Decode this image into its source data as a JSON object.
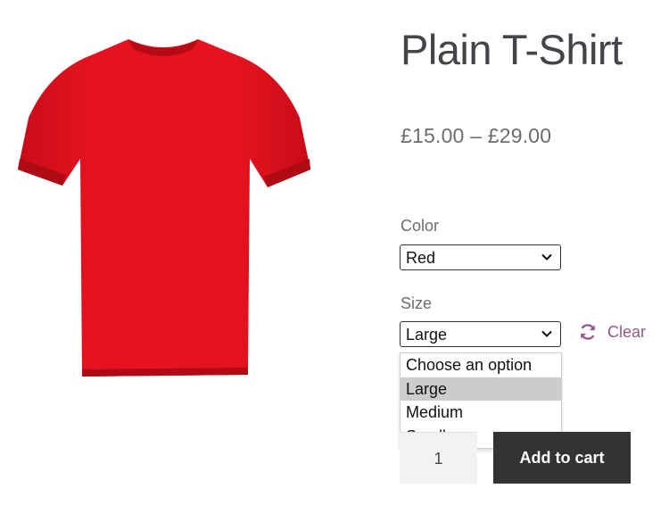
{
  "product": {
    "title": "Plain T-Shirt",
    "price_range": "£15.00 – £29.00",
    "image_icon": "red-tshirt-image",
    "image_color": "#e0101e"
  },
  "variations": {
    "color": {
      "label": "Color",
      "selected": "Red"
    },
    "size": {
      "label": "Size",
      "selected": "Large",
      "options": [
        "Choose an option",
        "Large",
        "Medium",
        "Small"
      ],
      "highlighted": "Large"
    },
    "clear_label": "Clear",
    "clear_icon": "refresh-icon"
  },
  "cart": {
    "quantity": "1",
    "add_to_cart_label": "Add to cart"
  },
  "colors": {
    "accent": "#96588a",
    "button_bg": "#333333",
    "text": "#43454b",
    "muted": "#6d6d6d"
  }
}
